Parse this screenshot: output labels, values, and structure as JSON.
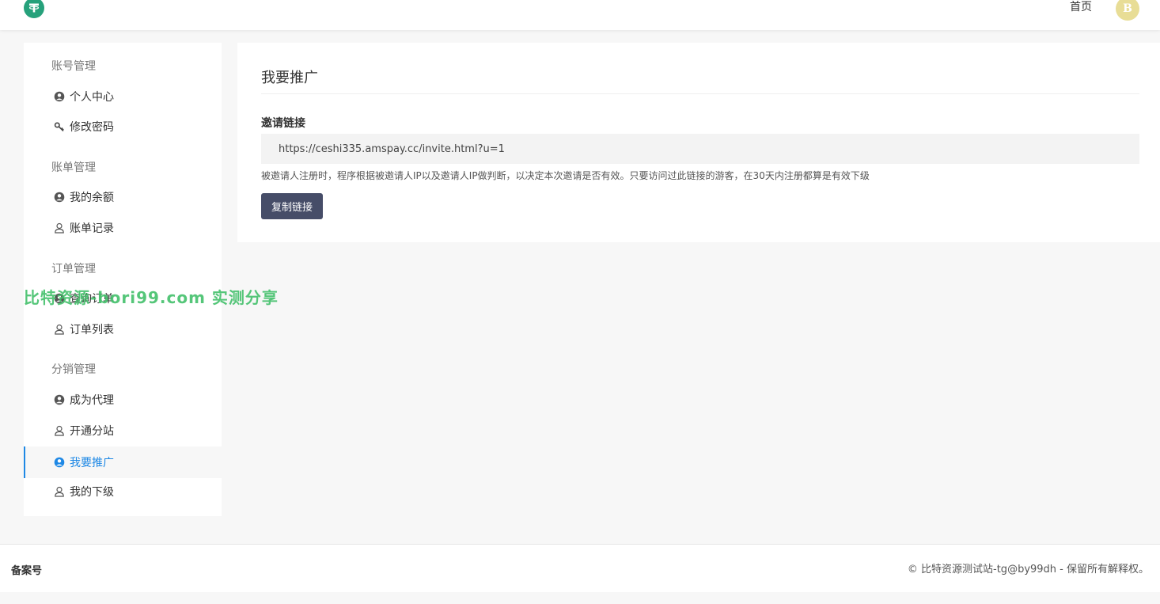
{
  "header": {
    "home_label": "首页",
    "avatar_letter": "B",
    "logo_color": "#26a17b",
    "avatar_color": "#e8dd96"
  },
  "sidebar": {
    "groups": [
      {
        "title": "账号管理",
        "items": [
          {
            "label": "个人中心",
            "icon": "user-circle-icon"
          },
          {
            "label": "修改密码",
            "icon": "key-icon"
          }
        ]
      },
      {
        "title": "账单管理",
        "items": [
          {
            "label": "我的余额",
            "icon": "user-circle-icon"
          },
          {
            "label": "账单记录",
            "icon": "user-outline-icon"
          }
        ]
      },
      {
        "title": "订单管理",
        "items": [
          {
            "label": "查询订单",
            "icon": "user-circle-icon"
          },
          {
            "label": "订单列表",
            "icon": "user-outline-icon"
          }
        ]
      },
      {
        "title": "分销管理",
        "items": [
          {
            "label": "成为代理",
            "icon": "user-circle-icon"
          },
          {
            "label": "开通分站",
            "icon": "user-outline-icon"
          },
          {
            "label": "我要推广",
            "icon": "user-circle-icon",
            "active": true
          },
          {
            "label": "我的下级",
            "icon": "user-outline-icon"
          }
        ]
      }
    ],
    "active_color": "#1e88e5"
  },
  "main": {
    "title": "我要推广",
    "invite_label": "邀请链接",
    "invite_url": "https://ceshi335.amspay.cc/invite.html?u=1",
    "hint": "被邀请人注册时，程序根据被邀请人IP以及邀请人IP做判断，以决定本次邀请是否有效。只要访问过此链接的游客，在30天内注册都算是有效下级",
    "copy_button": "复制链接",
    "button_color": "#464d68"
  },
  "watermark": "比特资源-bori99.com 实测分享",
  "footer": {
    "beian": "备案号",
    "copyright": "© 比特资源测试站-tg@by99dh - 保留所有解释权。"
  }
}
